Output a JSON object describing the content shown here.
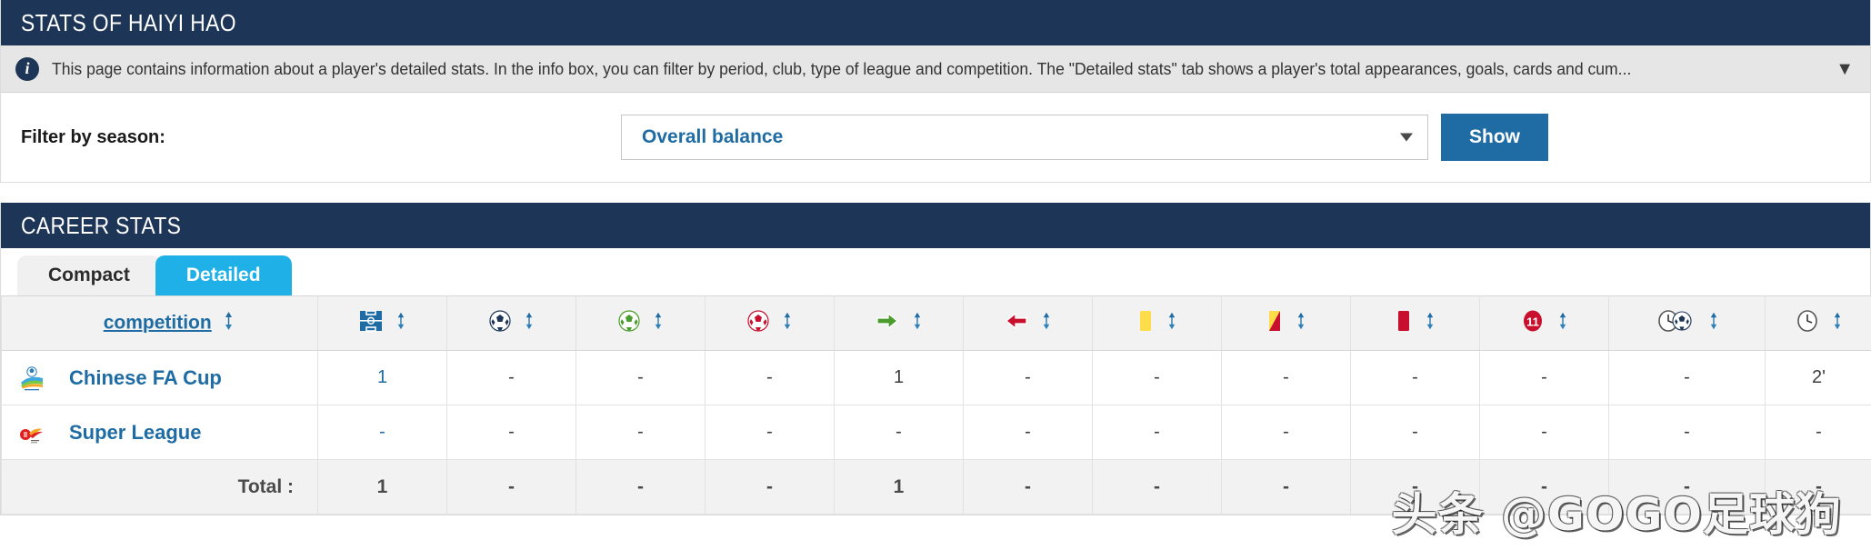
{
  "stats_panel": {
    "title": "STATS OF HAIYI HAO",
    "info": {
      "icon": "info-icon",
      "text": "This page contains information about a player's detailed stats. In the info box, you can filter by period, club, type of league and competition. The \"Detailed stats\" tab shows a player's total appearances, goals, cards and cum...",
      "expand_icon": "chevron-down-icon"
    },
    "filter": {
      "label": "Filter by season:",
      "season_selected": "Overall balance",
      "dropdown_icon": "caret-down-icon",
      "show_button": "Show"
    }
  },
  "career_panel": {
    "title": "CAREER STATS",
    "tabs": [
      {
        "label": "Compact",
        "active": false
      },
      {
        "label": "Detailed",
        "active": true
      }
    ],
    "table": {
      "columns": [
        {
          "key": "competition",
          "label": "competition",
          "icon": "",
          "type": "text"
        },
        {
          "key": "appearances",
          "label": "",
          "icon": "pitch-icon",
          "type": "icon"
        },
        {
          "key": "goals",
          "label": "",
          "icon": "football-blue-icon",
          "type": "icon"
        },
        {
          "key": "assists",
          "label": "",
          "icon": "football-green-icon",
          "type": "icon"
        },
        {
          "key": "own_goals",
          "label": "",
          "icon": "football-red-icon",
          "type": "icon"
        },
        {
          "key": "subbed_on",
          "label": "",
          "icon": "arrow-right-green-icon",
          "type": "icon"
        },
        {
          "key": "subbed_off",
          "label": "",
          "icon": "arrow-left-red-icon",
          "type": "icon"
        },
        {
          "key": "yellow_cards",
          "label": "",
          "icon": "yellow-card-icon",
          "type": "icon"
        },
        {
          "key": "second_yellow_cards",
          "label": "",
          "icon": "yellow-red-card-icon",
          "type": "icon"
        },
        {
          "key": "red_cards",
          "label": "",
          "icon": "red-card-icon",
          "type": "icon"
        },
        {
          "key": "penalty_goals",
          "label": "",
          "icon": "penalty-11-icon",
          "type": "icon"
        },
        {
          "key": "minutes_per_goal",
          "label": "",
          "icon": "clock-football-icon",
          "type": "icon"
        },
        {
          "key": "minutes_played",
          "label": "",
          "icon": "clock-icon",
          "type": "icon"
        }
      ],
      "sort_icon": "sort-updown-icon",
      "rows": [
        {
          "logo": "chinese-fa-cup-logo",
          "competition": "Chinese FA Cup",
          "values": [
            "1",
            "-",
            "-",
            "-",
            "1",
            "-",
            "-",
            "-",
            "-",
            "-",
            "-",
            "2'"
          ]
        },
        {
          "logo": "chinese-super-league-logo",
          "competition": "Super League",
          "values": [
            "-",
            "-",
            "-",
            "-",
            "-",
            "-",
            "-",
            "-",
            "-",
            "-",
            "-",
            "-"
          ]
        }
      ],
      "total_row": {
        "label": "Total :",
        "values": [
          "1",
          "-",
          "-",
          "-",
          "1",
          "-",
          "-",
          "-",
          "-",
          "-",
          "-",
          "-"
        ]
      }
    }
  },
  "watermark": "头条 @GOGO足球狗",
  "colors": {
    "header_navy": "#1d3557",
    "accent_blue": "#1e6ca3",
    "tab_active": "#20b0e8",
    "info_bg": "#e6e6e6",
    "yellow_card": "#ffdd4a",
    "red_card": "#c8102e",
    "green": "#4a9c2d"
  }
}
